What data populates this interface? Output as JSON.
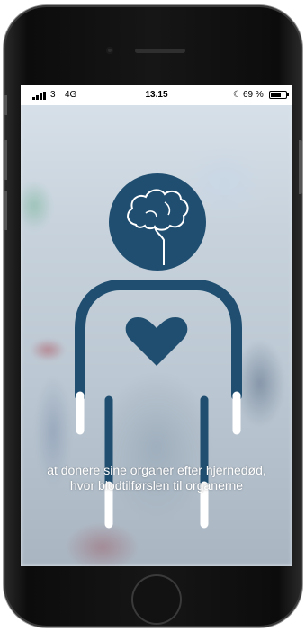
{
  "status_bar": {
    "carrier": "3",
    "network": "4G",
    "time": "13.15",
    "battery_percent": "69 %",
    "battery_level": 0.69,
    "moon_icon": "moon-icon",
    "signal_icon": "signal-bars-icon"
  },
  "illustration": {
    "brain_icon": "brain-icon",
    "heart_icon": "heart-icon",
    "primary_color": "#1f4e70"
  },
  "caption": {
    "line1": "at donere sine organer efter hjernedød,",
    "line2": "hvor blodtilførslen til organerne"
  }
}
